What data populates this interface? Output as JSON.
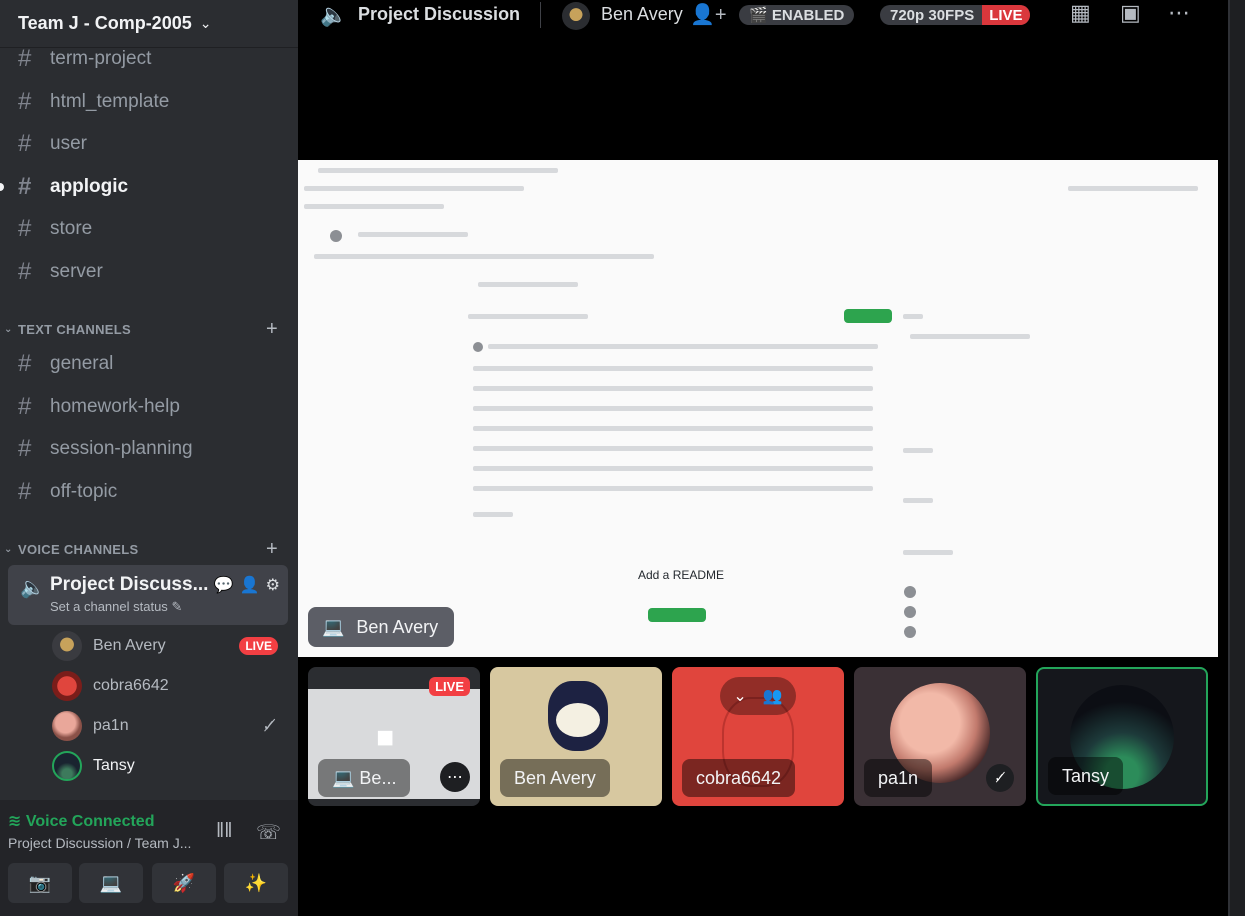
{
  "server": {
    "name": "Team J - Comp-2005"
  },
  "channels_top": [
    {
      "name": "term-project"
    },
    {
      "name": "html_template"
    },
    {
      "name": "user"
    },
    {
      "name": "applogic"
    },
    {
      "name": "store"
    },
    {
      "name": "server"
    }
  ],
  "text_category": {
    "label": "TEXT CHANNELS"
  },
  "text_channels": [
    {
      "name": "general"
    },
    {
      "name": "homework-help"
    },
    {
      "name": "session-planning"
    },
    {
      "name": "off-topic"
    }
  ],
  "voice_category": {
    "label": "VOICE CHANNELS"
  },
  "voice_channel": {
    "name": "Project Discuss...",
    "status": "Set a channel status"
  },
  "voice_users": [
    {
      "name": "Ben Avery",
      "badge": "LIVE"
    },
    {
      "name": "cobra6642"
    },
    {
      "name": "pa1n"
    },
    {
      "name": "Tansy"
    }
  ],
  "voice_panel": {
    "status": "Voice Connected",
    "location": "Project Discussion / Team J..."
  },
  "topbar": {
    "channel": "Project Discussion",
    "host": "Ben Avery",
    "enabled_pill": "ENABLED",
    "quality_pill": "720p 30FPS",
    "live_pill": "LIVE"
  },
  "stream": {
    "label": "Ben Avery",
    "readme_text": "Add a README"
  },
  "tiles": [
    {
      "label": "Be...",
      "badge": "LIVE"
    },
    {
      "label": "Ben Avery"
    },
    {
      "label": "cobra6642"
    },
    {
      "label": "pa1n"
    },
    {
      "label": "Tansy"
    }
  ],
  "colors": {
    "sidebar": "#2b2d31",
    "accent_green": "#23a55a",
    "live_red": "#f23f43",
    "cobra_tile": "#e0453d",
    "ben_tile": "#d7c8a0"
  }
}
